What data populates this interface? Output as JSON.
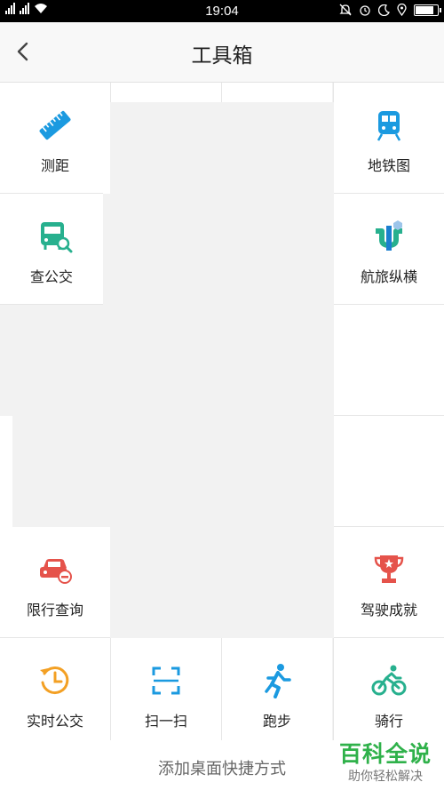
{
  "status": {
    "left": "4G 2G",
    "time": "19:04"
  },
  "title": "工具箱",
  "tools": {
    "ruler": "测距",
    "metro": "地铁图",
    "bus_query": "查公交",
    "travel": "航旅纵横",
    "restriction": "限行查询",
    "achievement": "驾驶成就",
    "realtime_bus": "实时公交",
    "scan": "扫一扫",
    "run": "跑步",
    "ride": "骑行"
  },
  "add_shortcut": "添加桌面快捷方式",
  "watermark": {
    "main": "百科全说",
    "sub": "助你轻松解决"
  },
  "colors": {
    "blue": "#1b9ae0",
    "teal": "#27b08e",
    "red": "#e5534b",
    "orange": "#f3a024"
  }
}
